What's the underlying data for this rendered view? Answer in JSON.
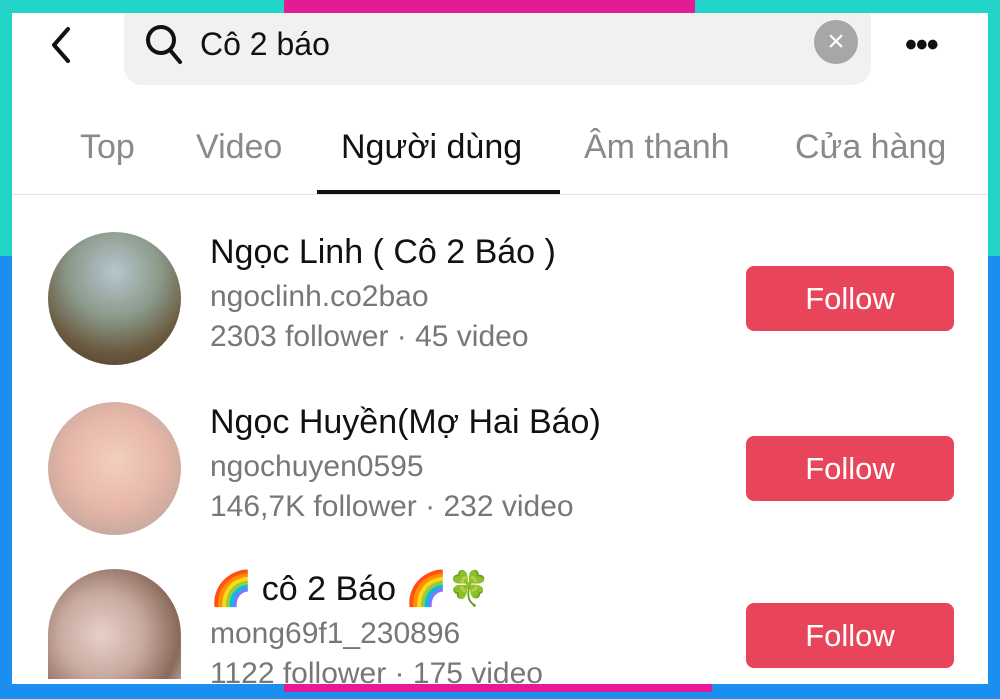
{
  "colors": {
    "frame_teal": "#22d3c8",
    "frame_blue": "#1a8ff0",
    "frame_magenta": "#e31c93",
    "follow_button": "#e8455a"
  },
  "header": {
    "back_icon": "chevron-left-icon",
    "search_icon": "magnifier-icon",
    "search_query": "Cô 2 báo",
    "clear_icon": "x-circle-icon",
    "more_icon": "ellipsis-icon",
    "more_label": "•••"
  },
  "tabs": [
    {
      "label": "Top"
    },
    {
      "label": "Video"
    },
    {
      "label": "Người dùng",
      "active": true
    },
    {
      "label": "Âm thanh"
    },
    {
      "label": "Cửa hàng"
    }
  ],
  "users": [
    {
      "name": "Ngọc Linh ( Cô 2 Báo )",
      "handle": "ngoclinh.co2bao",
      "stats": "2303 follower · 45 video",
      "button": "Follow"
    },
    {
      "name": "Ngọc Huyền(Mợ Hai Báo)",
      "handle": "ngochuyen0595",
      "stats": "146,7K follower · 232 video",
      "button": "Follow"
    },
    {
      "name": "🌈 cô 2 Báo 🌈🍀",
      "handle": "mong69f1_230896",
      "stats": "1122 follower · 175 video",
      "button": "Follow"
    }
  ]
}
